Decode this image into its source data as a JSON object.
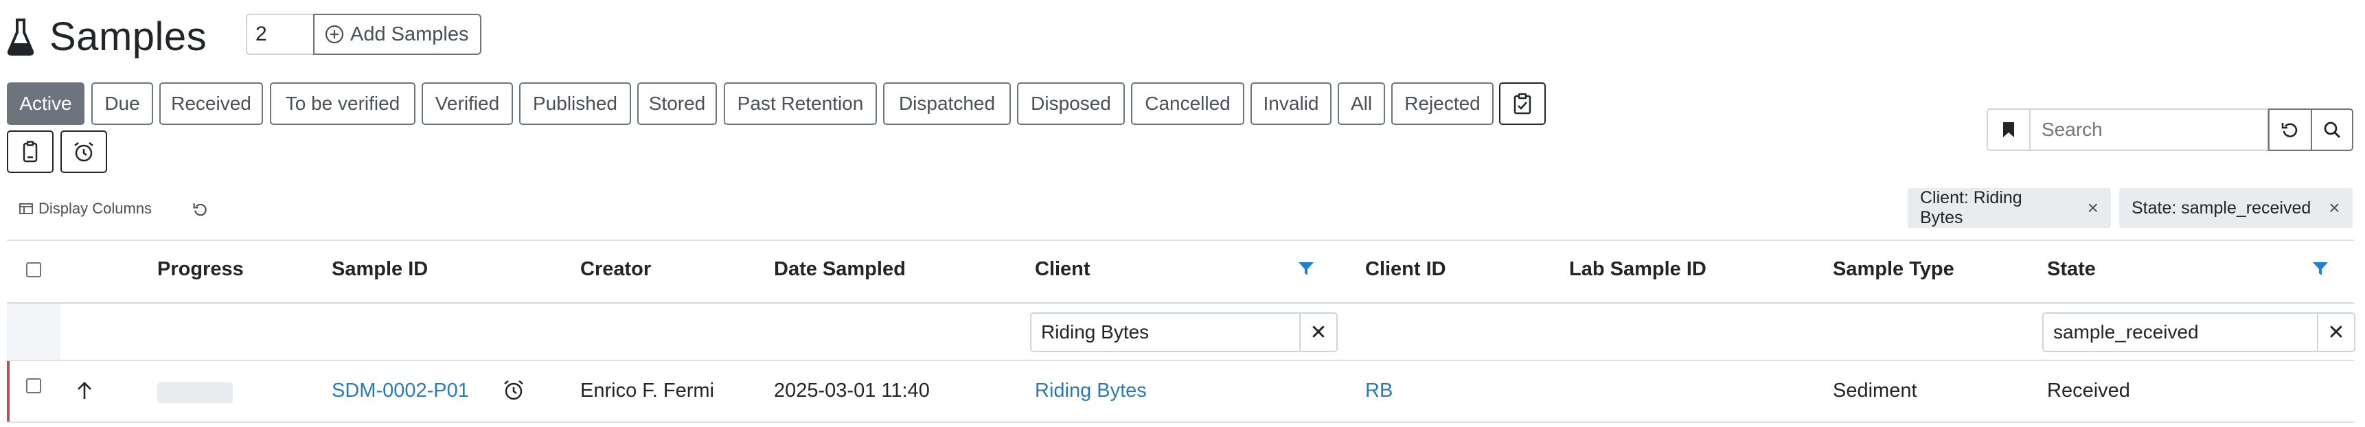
{
  "header": {
    "title": "Samples",
    "count_value": "2",
    "add_button_label": "Add Samples"
  },
  "review_states": [
    {
      "label": "Active",
      "active": true
    },
    {
      "label": "Due"
    },
    {
      "label": "Received"
    },
    {
      "label": "To be verified"
    },
    {
      "label": "Verified"
    },
    {
      "label": "Published"
    },
    {
      "label": "Stored"
    },
    {
      "label": "Past Retention"
    },
    {
      "label": "Dispatched"
    },
    {
      "label": "Disposed"
    },
    {
      "label": "Cancelled"
    },
    {
      "label": "Invalid"
    },
    {
      "label": "All"
    },
    {
      "label": "Rejected"
    }
  ],
  "search": {
    "placeholder": "Search",
    "value": ""
  },
  "toolbar": {
    "display_columns_label": "Display Columns"
  },
  "active_filters": [
    {
      "label": "Client: Riding Bytes"
    },
    {
      "label": "State: sample_received"
    }
  ],
  "table": {
    "columns": [
      "Progress",
      "Sample ID",
      "Creator",
      "Date Sampled",
      "Client",
      "Client ID",
      "Lab Sample ID",
      "Sample Type",
      "State"
    ],
    "column_filters": {
      "client": "Riding Bytes",
      "state": "sample_received"
    },
    "rows": [
      {
        "progress": 0,
        "sample_id": "SDM-0002-P01",
        "creator": "Enrico F. Fermi",
        "date_sampled": "2025-03-01 11:40",
        "client": "Riding Bytes",
        "client_id": "RB",
        "lab_sample_id": "",
        "sample_type": "Sediment",
        "state": "Received"
      }
    ]
  },
  "colors": {
    "accent_link": "#2a79b8",
    "active_button": "#6c757d",
    "row_marker": "#b5515a",
    "filter_funnel": "#1e7fd9"
  }
}
